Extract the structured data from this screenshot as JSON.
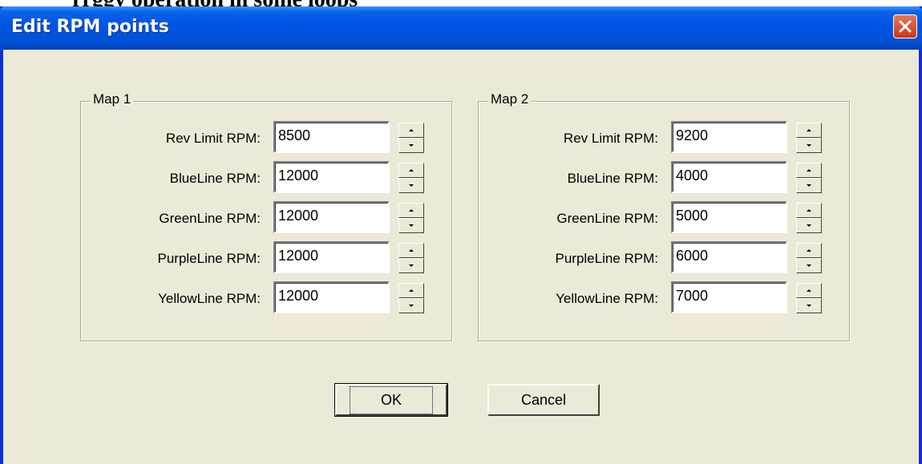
{
  "background_heading": "rrggy operation in some loops",
  "window": {
    "title": "Edit RPM points",
    "close_icon": "close-x-icon",
    "titlebar_color": "#0054e3",
    "close_color": "#d5482a"
  },
  "map1": {
    "legend": "Map 1",
    "rows": [
      {
        "label": "Rev Limit  RPM:",
        "value": "8500"
      },
      {
        "label": "BlueLine RPM:",
        "value": "12000"
      },
      {
        "label": "GreenLine RPM:",
        "value": "12000"
      },
      {
        "label": "PurpleLine RPM:",
        "value": "12000"
      },
      {
        "label": "YellowLine RPM:",
        "value": "12000"
      }
    ]
  },
  "map2": {
    "legend": "Map 2",
    "rows": [
      {
        "label": "Rev Limit  RPM:",
        "value": "9200"
      },
      {
        "label": "BlueLine RPM:",
        "value": "4000"
      },
      {
        "label": "GreenLine RPM:",
        "value": "5000"
      },
      {
        "label": "PurpleLine RPM:",
        "value": "6000"
      },
      {
        "label": "YellowLine RPM:",
        "value": "7000"
      }
    ]
  },
  "buttons": {
    "ok": "OK",
    "cancel": "Cancel"
  }
}
